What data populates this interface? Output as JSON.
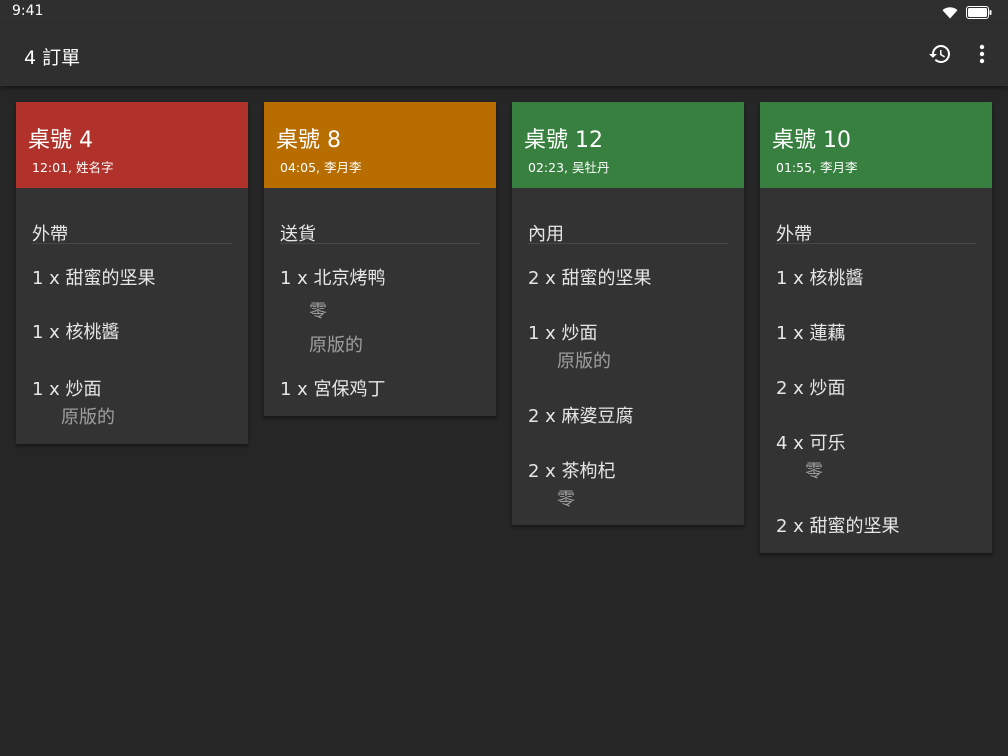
{
  "status_bar": {
    "time": "9:41",
    "icons": [
      "wifi-icon",
      "battery-icon"
    ]
  },
  "app_bar": {
    "title": "4 訂單",
    "actions": [
      "history-icon",
      "more-vert-icon"
    ]
  },
  "colors": {
    "background": "#262626",
    "card": "#333333",
    "red": "#b0322a",
    "orange": "#b86d00",
    "green": "#37803f"
  },
  "orders": [
    {
      "title": "桌號 4",
      "subtitle": "12:01, 姓名字",
      "header_color": "#b0322a",
      "type": "外帶",
      "items": [
        {
          "text": "1 x 甜蜜的坚果",
          "mods": []
        },
        {
          "text": "1 x 核桃醬",
          "mods": []
        },
        {
          "text": "1 x 炒面",
          "mods": [
            "原版的"
          ]
        }
      ]
    },
    {
      "title": "桌號 8",
      "subtitle": "04:05, 李月李",
      "header_color": "#b86d00",
      "type": "送貨",
      "items": [
        {
          "text": "1 x 北京烤鸭",
          "mods": [
            "零",
            "原版的"
          ]
        },
        {
          "text": "1 x 宮保鸡丁",
          "mods": []
        }
      ]
    },
    {
      "title": "桌號 12",
      "subtitle": "02:23, 吴牡丹",
      "header_color": "#37803f",
      "type": "內用",
      "items": [
        {
          "text": "2 x 甜蜜的坚果",
          "mods": []
        },
        {
          "text": "1 x 炒面",
          "mods": [
            "原版的"
          ]
        },
        {
          "text": "2 x 麻婆豆腐",
          "mods": []
        },
        {
          "text": "2 x 茶枸杞",
          "mods": [
            "零"
          ]
        }
      ]
    },
    {
      "title": "桌號 10",
      "subtitle": "01:55, 李月李",
      "header_color": "#37803f",
      "type": "外帶",
      "items": [
        {
          "text": "1 x 核桃醬",
          "mods": []
        },
        {
          "text": "1 x 蓮藕",
          "mods": []
        },
        {
          "text": "2 x 炒面",
          "mods": []
        },
        {
          "text": "4 x 可乐",
          "mods": [
            "零"
          ]
        },
        {
          "text": "2 x 甜蜜的坚果",
          "mods": []
        }
      ]
    }
  ]
}
